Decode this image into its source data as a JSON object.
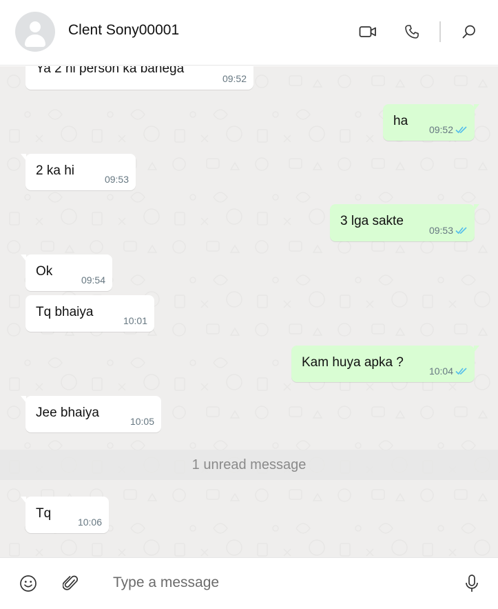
{
  "header": {
    "contact_name": "Clent Sony00001",
    "icons": [
      "avatar-icon",
      "video-call-icon",
      "voice-call-icon",
      "search-icon"
    ]
  },
  "messages": [
    {
      "dir": "in",
      "text": "Ya 2 hi person ka banega",
      "time": "09:52"
    },
    {
      "dir": "out",
      "text": "ha",
      "time": "09:52",
      "status": "read"
    },
    {
      "dir": "in",
      "text": "2 ka hi",
      "time": "09:53"
    },
    {
      "dir": "out",
      "text": "3 lga sakte",
      "time": "09:53",
      "status": "read"
    },
    {
      "dir": "in",
      "text": "Ok",
      "time": "09:54"
    },
    {
      "dir": "in",
      "text": "Tq bhaiya",
      "time": "10:01"
    },
    {
      "dir": "out",
      "text": "Kam huya apka ?",
      "time": "10:04",
      "status": "read"
    },
    {
      "dir": "in",
      "text": "Jee bhaiya",
      "time": "10:05"
    },
    {
      "dir": "in",
      "text": "Tq",
      "time": "10:06"
    }
  ],
  "unread_divider": "1 unread message",
  "composer": {
    "placeholder": "Type a message",
    "icons": [
      "emoji-icon",
      "attach-icon",
      "mic-icon"
    ]
  },
  "colors": {
    "outgoing_bubble": "#d9fdd3",
    "incoming_bubble": "#ffffff",
    "chat_background": "#efeeed",
    "read_ticks": "#53bdeb"
  }
}
